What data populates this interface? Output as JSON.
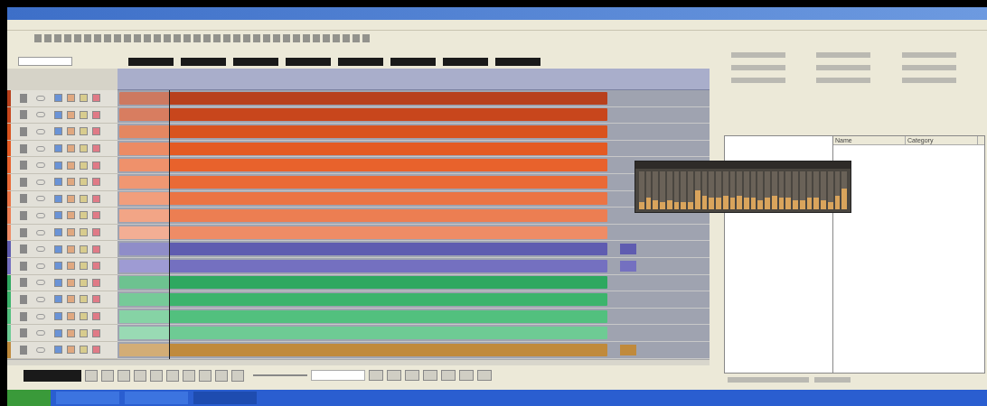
{
  "tracks": [
    {
      "color": "#b8401c",
      "extra_clip": false
    },
    {
      "color": "#c8461c",
      "extra_clip": false
    },
    {
      "color": "#d9531e",
      "extra_clip": false
    },
    {
      "color": "#e45a22",
      "extra_clip": false
    },
    {
      "color": "#e8622c",
      "extra_clip": false
    },
    {
      "color": "#ea6a36",
      "extra_clip": false
    },
    {
      "color": "#eb7444",
      "extra_clip": false
    },
    {
      "color": "#ec7e52",
      "extra_clip": false
    },
    {
      "color": "#ee8c66",
      "extra_clip": false
    },
    {
      "color": "#5f5cb0",
      "extra_clip": true
    },
    {
      "color": "#7470c0",
      "extra_clip": true
    },
    {
      "color": "#2ea860",
      "extra_clip": false
    },
    {
      "color": "#3cb46c",
      "extra_clip": false
    },
    {
      "color": "#52c07e",
      "extra_clip": false
    },
    {
      "color": "#6ecb94",
      "extra_clip": false
    },
    {
      "color": "#c08a3c",
      "extra_clip": true
    }
  ],
  "mixer": {
    "meters": [
      {
        "level": 0.2
      },
      {
        "level": 0.3
      },
      {
        "level": 0.25
      },
      {
        "level": 0.2
      },
      {
        "level": 0.25
      },
      {
        "level": 0.2
      },
      {
        "level": 0.2
      },
      {
        "level": 0.2
      },
      {
        "level": 0.5
      },
      {
        "level": 0.35
      },
      {
        "level": 0.3
      },
      {
        "level": 0.3
      },
      {
        "level": 0.35
      },
      {
        "level": 0.3
      },
      {
        "level": 0.35
      },
      {
        "level": 0.3
      },
      {
        "level": 0.3
      },
      {
        "level": 0.25
      },
      {
        "level": 0.3
      },
      {
        "level": 0.35
      },
      {
        "level": 0.3
      },
      {
        "level": 0.3
      },
      {
        "level": 0.25
      },
      {
        "level": 0.25
      },
      {
        "level": 0.3
      },
      {
        "level": 0.3
      },
      {
        "level": 0.25
      },
      {
        "level": 0.2
      },
      {
        "level": 0.35
      },
      {
        "level": 0.55
      }
    ]
  },
  "media_list": {
    "columns": [
      "Name",
      "Category"
    ]
  }
}
